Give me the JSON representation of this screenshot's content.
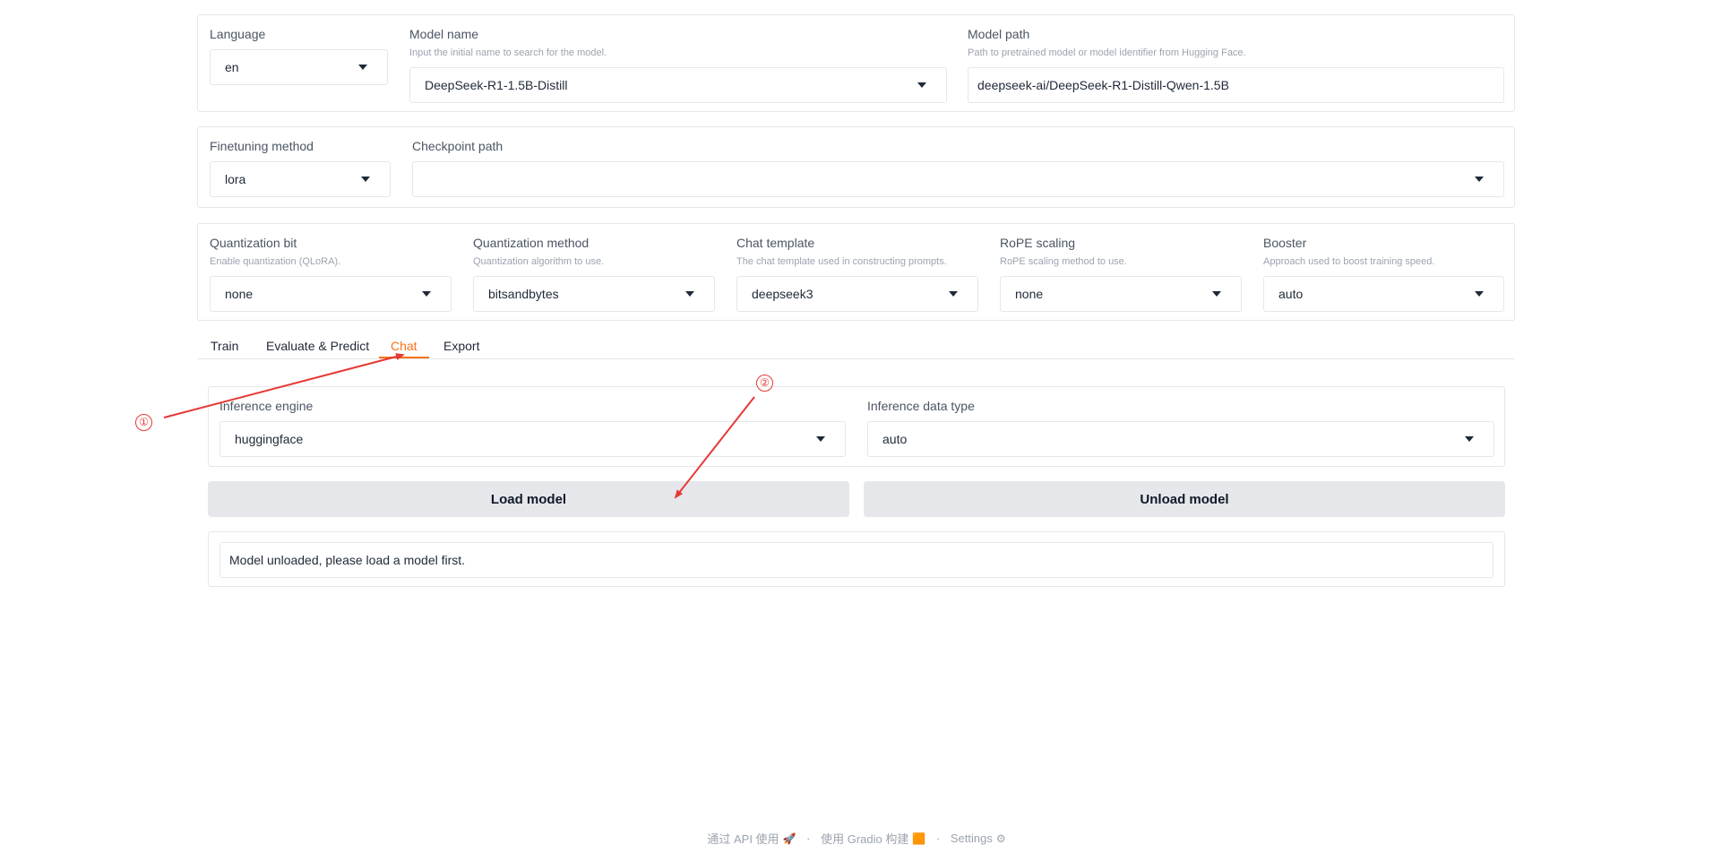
{
  "model_panel": {
    "language": {
      "label": "Language",
      "value": "en"
    },
    "model_name": {
      "label": "Model name",
      "info": "Input the initial name to search for the model.",
      "value": "DeepSeek-R1-1.5B-Distill"
    },
    "model_path": {
      "label": "Model path",
      "info": "Path to pretrained model or model identifier from Hugging Face.",
      "value": "deepseek-ai/DeepSeek-R1-Distill-Qwen-1.5B"
    }
  },
  "finetune_panel": {
    "method": {
      "label": "Finetuning method",
      "value": "lora"
    },
    "checkpoint": {
      "label": "Checkpoint path",
      "value": ""
    }
  },
  "advanced_panel": {
    "quant_bit": {
      "label": "Quantization bit",
      "info": "Enable quantization (QLoRA).",
      "value": "none"
    },
    "quant_method": {
      "label": "Quantization method",
      "info": "Quantization algorithm to use.",
      "value": "bitsandbytes"
    },
    "template": {
      "label": "Chat template",
      "info": "The chat template used in constructing prompts.",
      "value": "deepseek3"
    },
    "rope": {
      "label": "RoPE scaling",
      "info": "RoPE scaling method to use.",
      "value": "none"
    },
    "booster": {
      "label": "Booster",
      "info": "Approach used to boost training speed.",
      "value": "auto"
    }
  },
  "tabs": [
    {
      "label": "Train",
      "active": false
    },
    {
      "label": "Evaluate & Predict",
      "active": false
    },
    {
      "label": "Chat",
      "active": true
    },
    {
      "label": "Export",
      "active": false
    }
  ],
  "chat": {
    "infer_backend": {
      "label": "Inference engine",
      "value": "huggingface"
    },
    "infer_dtype": {
      "label": "Inference data type",
      "value": "auto"
    },
    "load_label": "Load model",
    "unload_label": "Unload model",
    "info_box": "Model unloaded, please load a model first."
  },
  "annotations": {
    "mark_1": "①",
    "mark_2": "②",
    "color": "#e53935"
  },
  "footer": {
    "api": "通过 API 使用",
    "api_icon": "🚀",
    "built": "使用 Gradio 构建",
    "built_icon": "🟧",
    "settings": "Settings",
    "settings_icon": "⚙",
    "dot": "·"
  },
  "colors": {
    "accent": "#f97316",
    "button_bg": "#e5e7eb",
    "border": "#e5e7eb"
  }
}
